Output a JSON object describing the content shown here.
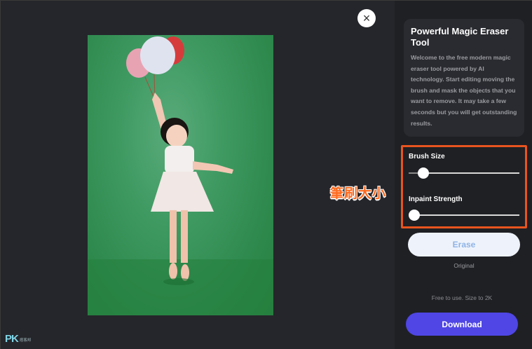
{
  "close_button": {
    "icon": "close-icon",
    "glyph": "×"
  },
  "sidebar": {
    "info_title": "Powerful Magic Eraser Tool",
    "info_description": "Welcome to the free modern magic eraser tool powered by AI technology. Start editing moving the brush and mask the objects that you want to remove. It may take a few seconds but you will get outstanding results.",
    "brush_size_label": "Brush Size",
    "brush_size_value": 0.13,
    "inpaint_strength_label": "Inpaint Strength",
    "inpaint_strength_value": 0.0,
    "erase_label": "Erase",
    "original_label": "Original",
    "free_note": "Free to use. Size to 2K",
    "download_label": "Download"
  },
  "annotation": {
    "text": "筆刷大小",
    "color": "#ff6a1f"
  },
  "watermark": {
    "logo": "PK",
    "text": "痞客邦"
  },
  "colors": {
    "accent_download": "#4f46e5",
    "erase_text": "#8fb3e6",
    "highlight_border": "#e8541e",
    "background": "#25262b"
  }
}
